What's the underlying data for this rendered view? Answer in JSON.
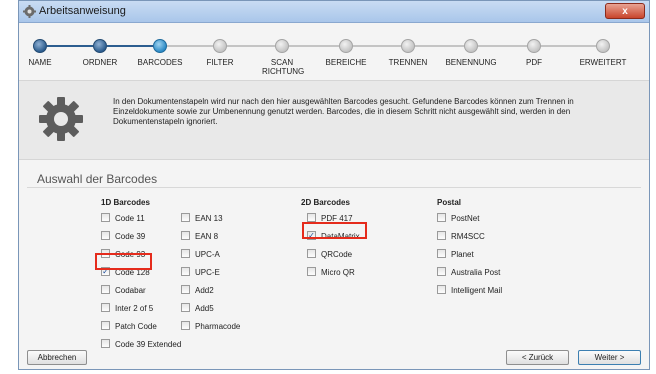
{
  "window": {
    "title": "Arbeitsanweisung",
    "close_label": "x"
  },
  "steps": [
    {
      "label": "NAME",
      "state": "done"
    },
    {
      "label": "ORDNER",
      "state": "done"
    },
    {
      "label": "BARCODES",
      "state": "current"
    },
    {
      "label": "FILTER",
      "state": "todo"
    },
    {
      "label": "SCAN RICHTUNG",
      "state": "todo"
    },
    {
      "label": "BEREICHE",
      "state": "todo"
    },
    {
      "label": "TRENNEN",
      "state": "todo"
    },
    {
      "label": "BENENNUNG",
      "state": "todo"
    },
    {
      "label": "PDF",
      "state": "todo"
    },
    {
      "label": "ERWEITERT",
      "state": "todo"
    }
  ],
  "info_text": "In den Dokumentenstapeln wird nur nach den hier ausgewählten Barcodes gesucht. Gefundene Barcodes können zum Trennen in Einzeldokumente sowie zur Umbenennung genutzt werden. Barcodes, die in diesem Schritt nicht ausgewählt sind, werden in den Dokumentenstapeln ignoriert.",
  "section_title": "Auswahl der Barcodes",
  "groups": {
    "one_d": {
      "title": "1D Barcodes",
      "col1": [
        {
          "label": "Code 11",
          "checked": false
        },
        {
          "label": "Code 39",
          "checked": false
        },
        {
          "label": "Code 93",
          "checked": false
        },
        {
          "label": "Code 128",
          "checked": true
        },
        {
          "label": "Codabar",
          "checked": false
        },
        {
          "label": "Inter 2 of 5",
          "checked": false
        },
        {
          "label": "Patch Code",
          "checked": false
        },
        {
          "label": "Code 39 Extended",
          "checked": false
        }
      ],
      "col2": [
        {
          "label": "EAN 13",
          "checked": false
        },
        {
          "label": "EAN 8",
          "checked": false
        },
        {
          "label": "UPC-A",
          "checked": false
        },
        {
          "label": "UPC-E",
          "checked": false
        },
        {
          "label": "Add2",
          "checked": false
        },
        {
          "label": "Add5",
          "checked": false
        },
        {
          "label": "Pharmacode",
          "checked": false
        }
      ]
    },
    "two_d": {
      "title": "2D Barcodes",
      "items": [
        {
          "label": "PDF 417",
          "checked": false
        },
        {
          "label": "DataMatrix",
          "checked": true
        },
        {
          "label": "QRCode",
          "checked": false
        },
        {
          "label": "Micro QR",
          "checked": false
        }
      ]
    },
    "postal": {
      "title": "Postal",
      "items": [
        {
          "label": "PostNet",
          "checked": false
        },
        {
          "label": "RM4SCC",
          "checked": false
        },
        {
          "label": "Planet",
          "checked": false
        },
        {
          "label": "Australia Post",
          "checked": false
        },
        {
          "label": "Intelligent Mail",
          "checked": false
        }
      ]
    }
  },
  "buttons": {
    "cancel": "Abbrechen",
    "back": "< Zurück",
    "next": "Weiter >"
  },
  "colors": {
    "highlight": "#e52b1c",
    "step_done": "#2c5d8f",
    "step_current": "#2d8bc6",
    "step_todo": "#c4c4c4"
  }
}
